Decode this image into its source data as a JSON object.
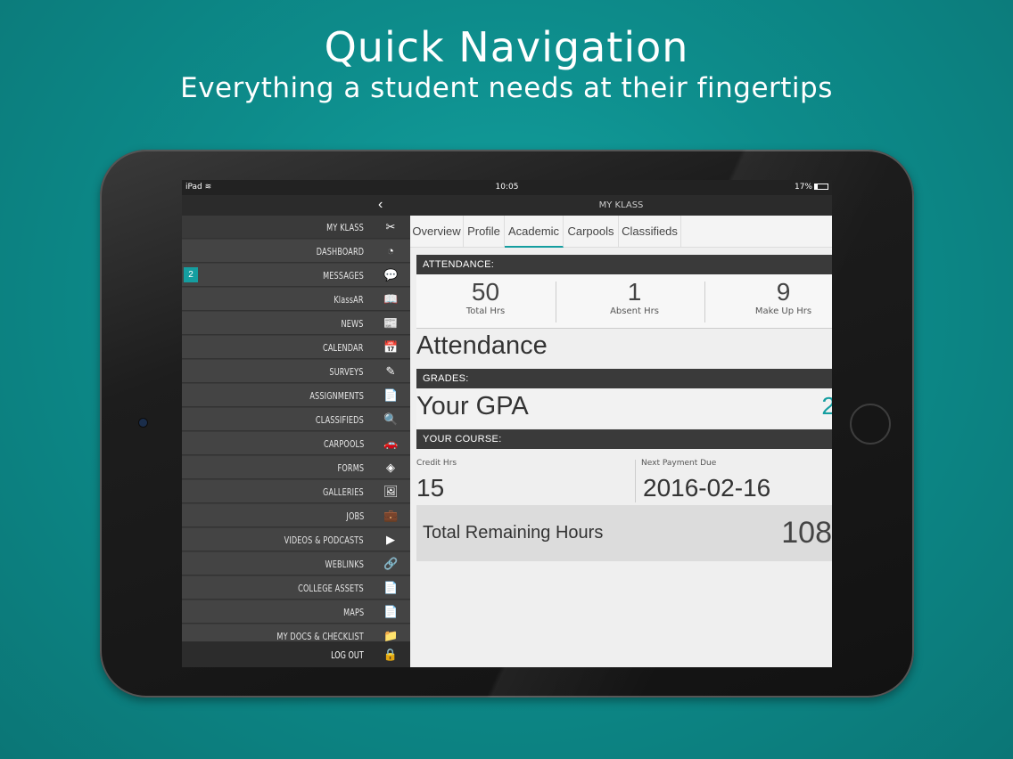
{
  "promo": {
    "title": "Quick Navigation",
    "subtitle": "Everything a student needs at their fingertips"
  },
  "status_bar": {
    "device": "iPad",
    "time": "10:05",
    "battery": "17%"
  },
  "nav": {
    "title": "MY KLASS",
    "back": "‹"
  },
  "sidebar": {
    "items": [
      {
        "label": "MY KLASS",
        "icon": "tools-icon",
        "glyph": "✂"
      },
      {
        "label": "DASHBOARD",
        "icon": "gauge-icon",
        "glyph": "◔"
      },
      {
        "label": "MESSAGES",
        "icon": "chat-bubbles-icon",
        "glyph": "💬",
        "badge": "2"
      },
      {
        "label": "KlassAR",
        "icon": "book-icon",
        "glyph": "📖"
      },
      {
        "label": "NEWS",
        "icon": "newspaper-icon",
        "glyph": "📰"
      },
      {
        "label": "CALENDAR",
        "icon": "calendar-icon",
        "glyph": "📅"
      },
      {
        "label": "SURVEYS",
        "icon": "pencil-icon",
        "glyph": "✎"
      },
      {
        "label": "ASSIGNMENTS",
        "icon": "document-icon",
        "glyph": "📄"
      },
      {
        "label": "CLASSIFIEDS",
        "icon": "classifieds-icon",
        "glyph": "🔍"
      },
      {
        "label": "CARPOOLS",
        "icon": "car-icon",
        "glyph": "🚗"
      },
      {
        "label": "FORMS",
        "icon": "layers-icon",
        "glyph": "◈"
      },
      {
        "label": "GALLERIES",
        "icon": "gallery-icon",
        "glyph": "🖼"
      },
      {
        "label": "JOBS",
        "icon": "briefcase-icon",
        "glyph": "💼"
      },
      {
        "label": "VIDEOS & PODCASTS",
        "icon": "play-icon",
        "glyph": "▶"
      },
      {
        "label": "WEBLINKS",
        "icon": "link-icon",
        "glyph": "🔗"
      },
      {
        "label": "COLLEGE ASSETS",
        "icon": "document-icon",
        "glyph": "📄"
      },
      {
        "label": "MAPS",
        "icon": "document-icon",
        "glyph": "📄"
      },
      {
        "label": "MY DOCS & CHECKLIST",
        "icon": "folder-icon",
        "glyph": "📁"
      }
    ],
    "logout": {
      "label": "LOG OUT",
      "icon": "lock-icon",
      "glyph": "🔒"
    }
  },
  "tabs": [
    "Overview",
    "Profile",
    "Academic",
    "Carpools",
    "Classifieds"
  ],
  "active_tab": "Academic",
  "attendance": {
    "section_label": "ATTENDANCE:",
    "stats": [
      {
        "value": "50",
        "label": "Total Hrs"
      },
      {
        "value": "1",
        "label": "Absent Hrs"
      },
      {
        "value": "9",
        "label": "Make Up Hrs"
      }
    ],
    "heading": "Attendance"
  },
  "grades": {
    "section_label": "GRADES:",
    "gpa_label": "Your GPA",
    "gpa_value": "2"
  },
  "course": {
    "section_label": "YOUR COURSE:",
    "credit_label": "Credit Hrs",
    "credit_value": "15",
    "payment_label": "Next Payment Due",
    "payment_value": "2016-02-16",
    "remaining_label": "Total Remaining Hours",
    "remaining_value": "108"
  },
  "colors": {
    "accent": "#159ea0",
    "background": "#0f8f8e",
    "sidebar": "#444444"
  }
}
